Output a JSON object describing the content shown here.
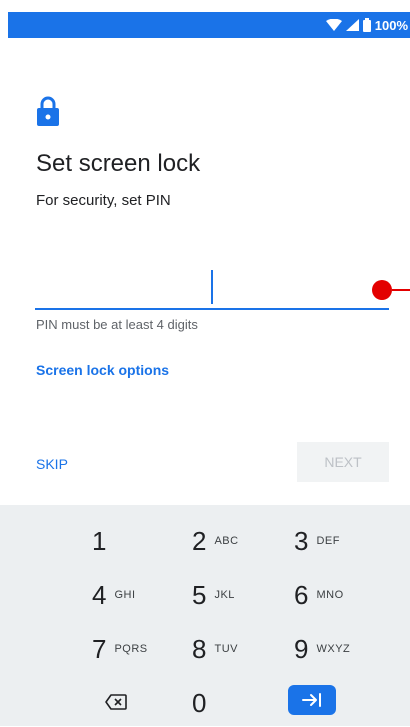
{
  "status_bar": {
    "battery_percent": "100%",
    "icons": [
      "wifi-icon",
      "cell-signal-icon",
      "battery-icon"
    ]
  },
  "header": {
    "icon": "lock-icon",
    "title": "Set screen lock",
    "subtitle": "For security, set PIN"
  },
  "pin_input": {
    "value": "",
    "hint": "PIN must be at least 4 digits"
  },
  "screen_lock_options_label": "Screen lock options",
  "skip_label": "SKIP",
  "next_label": "NEXT",
  "keypad": {
    "rows": [
      [
        {
          "digit": "1",
          "letters": ""
        },
        {
          "digit": "2",
          "letters": "ABC"
        },
        {
          "digit": "3",
          "letters": "DEF"
        }
      ],
      [
        {
          "digit": "4",
          "letters": "GHI"
        },
        {
          "digit": "5",
          "letters": "JKL"
        },
        {
          "digit": "6",
          "letters": "MNO"
        }
      ],
      [
        {
          "digit": "7",
          "letters": "PQRS"
        },
        {
          "digit": "8",
          "letters": "TUV"
        },
        {
          "digit": "9",
          "letters": "WXYZ"
        }
      ]
    ],
    "zero": "0",
    "backspace_icon": "backspace-icon",
    "enter_icon": "enter-arrow-icon"
  },
  "colors": {
    "accent": "#1a73e8",
    "keypad_bg": "#eceff1",
    "marker": "#e30000"
  }
}
